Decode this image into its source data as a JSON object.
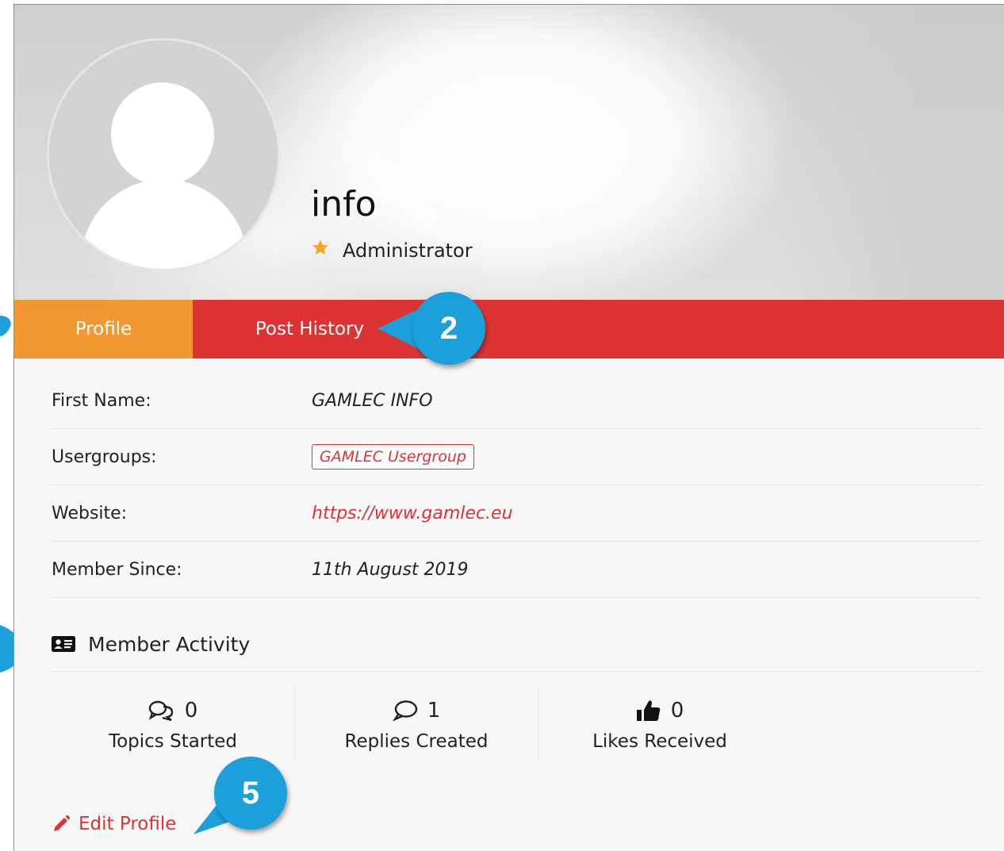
{
  "profile": {
    "display_name": "info",
    "role": "Administrator",
    "role_icon": "star-icon",
    "avatar": "default-avatar"
  },
  "tabs": [
    {
      "label": "Profile",
      "active": true
    },
    {
      "label": "Post History",
      "active": false
    }
  ],
  "info_rows": [
    {
      "label": "First Name:",
      "value": "GAMLEC INFO"
    },
    {
      "label": "Usergroups:",
      "value": "GAMLEC Usergroup"
    },
    {
      "label": "Website:",
      "value": "https://www.gamlec.eu"
    },
    {
      "label": "Member Since:",
      "value": "11th August 2019"
    }
  ],
  "activity": {
    "title": "Member Activity",
    "stats": [
      {
        "icon": "discussions-icon",
        "count": "0",
        "label": "Topics Started"
      },
      {
        "icon": "comment-icon",
        "count": "1",
        "label": "Replies Created"
      },
      {
        "icon": "thumbs-up-icon",
        "count": "0",
        "label": "Likes Received"
      }
    ]
  },
  "edit_profile": {
    "label": "Edit Profile",
    "icon": "pencil-icon"
  },
  "callouts": [
    "2",
    "5"
  ],
  "colors": {
    "accent": "#dd3333",
    "active_tab": "#f29833",
    "callout": "#1ba0dc",
    "star": "#f3a71c"
  }
}
